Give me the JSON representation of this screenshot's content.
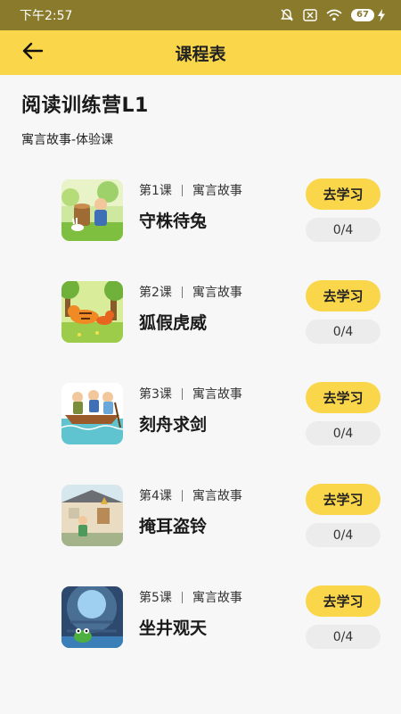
{
  "status_bar": {
    "time": "下午2:57",
    "battery": "67"
  },
  "app_bar": {
    "title": "课程表",
    "back_icon": "arrow-left-icon"
  },
  "header": {
    "camp_title": "阅读训练营L1",
    "subtitle": "寓言故事-体验课"
  },
  "lessons": [
    {
      "number": "第1课",
      "category": "寓言故事",
      "title": "守株待兔",
      "action": "去学习",
      "progress": "0/4"
    },
    {
      "number": "第2课",
      "category": "寓言故事",
      "title": "狐假虎威",
      "action": "去学习",
      "progress": "0/4"
    },
    {
      "number": "第3课",
      "category": "寓言故事",
      "title": "刻舟求剑",
      "action": "去学习",
      "progress": "0/4"
    },
    {
      "number": "第4课",
      "category": "寓言故事",
      "title": "掩耳盗铃",
      "action": "去学习",
      "progress": "0/4"
    },
    {
      "number": "第5课",
      "category": "寓言故事",
      "title": "坐井观天",
      "action": "去学习",
      "progress": "0/4"
    }
  ],
  "colors": {
    "accent": "#fad64a",
    "status_bar": "#897a2c",
    "background": "#f7f7f7",
    "progress_bg": "#ececec"
  }
}
